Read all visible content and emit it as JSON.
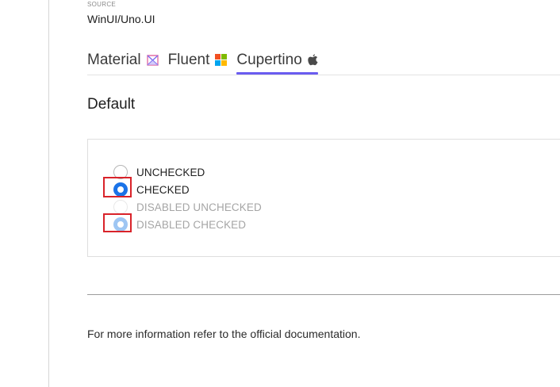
{
  "source": {
    "label": "SOURCE",
    "value": "WinUI/Uno.UI"
  },
  "tabs": [
    {
      "label": "Material",
      "icon": "material-logo-icon",
      "active": false
    },
    {
      "label": "Fluent",
      "icon": "windows-logo-icon",
      "active": false
    },
    {
      "label": "Cupertino",
      "icon": "apple-logo-icon",
      "active": true
    }
  ],
  "section": {
    "title": "Default"
  },
  "radios": [
    {
      "label": "UNCHECKED",
      "state": "unchecked",
      "disabled": false,
      "highlighted": false
    },
    {
      "label": "CHECKED",
      "state": "checked",
      "disabled": false,
      "highlighted": true
    },
    {
      "label": "DISABLED UNCHECKED",
      "state": "unchecked",
      "disabled": true,
      "highlighted": false
    },
    {
      "label": "DISABLED CHECKED",
      "state": "checked",
      "disabled": true,
      "highlighted": true
    }
  ],
  "footer": {
    "text": "For more information refer to the  official documentation."
  },
  "colors": {
    "accent": "#6a5cf0",
    "radio_checked": "#1a73e8",
    "radio_checked_disabled": "#9ec6f3",
    "highlight_box": "#d9232a"
  }
}
